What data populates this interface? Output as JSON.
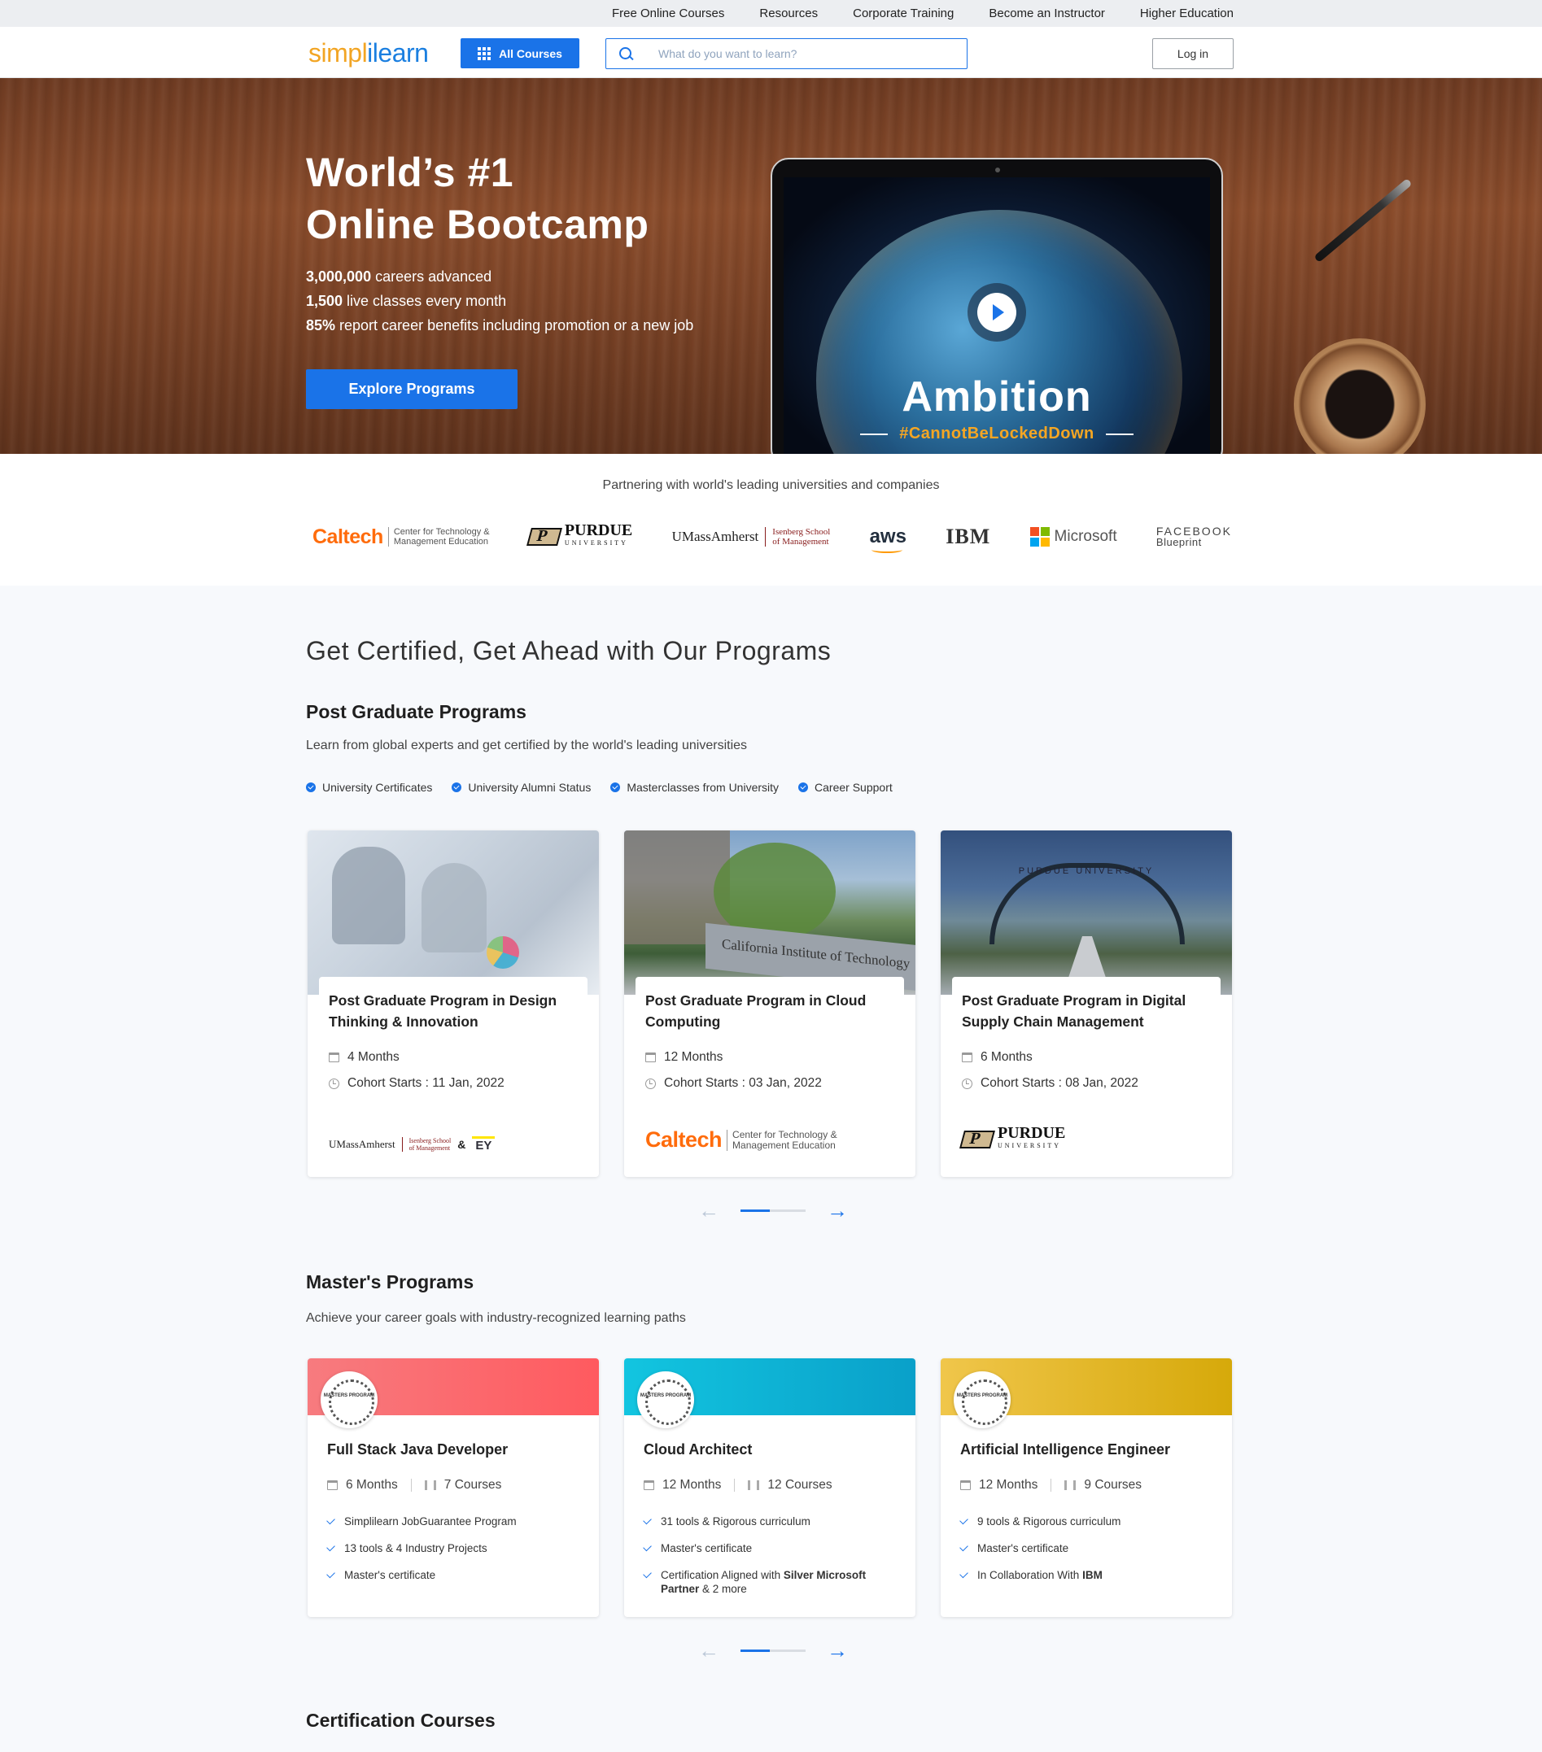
{
  "util_nav": [
    "Free Online Courses",
    "Resources",
    "Corporate Training",
    "Become an Instructor",
    "Higher Education"
  ],
  "header": {
    "logo_a": "simpl",
    "logo_b": "ilearn",
    "all_courses": "All Courses",
    "search_placeholder": "What do you want to learn?",
    "login": "Log in"
  },
  "hero": {
    "title_line1": "World’s #1",
    "title_line2": "Online Bootcamp",
    "stats": [
      {
        "num": "3,000,000",
        "text": " careers advanced"
      },
      {
        "num": "1,500",
        "text": " live classes every month"
      },
      {
        "num": "85%",
        "text": " report career benefits including promotion or a new job"
      }
    ],
    "cta": "Explore Programs",
    "video_title": "Ambition",
    "video_hashtag": "#CannotBeLockedDown"
  },
  "partners": {
    "title": "Partnering with world's leading universities and companies",
    "caltech": "Caltech",
    "caltech_sub1": "Center for Technology &",
    "caltech_sub2": "Management Education",
    "purdue": "PURDUE",
    "purdue_sub": "UNIVERSITY",
    "umass": "UMassAmherst",
    "umass_sub1": "Isenberg School",
    "umass_sub2": "of Management",
    "aws": "aws",
    "ibm": "IBM",
    "microsoft": "Microsoft",
    "fb_top": "FACEBOOK",
    "fb_bottom": "Blueprint",
    "ey": "EY"
  },
  "colors": {
    "accent": "#1a73e8",
    "caltech": "#ff6c0c",
    "ms_red": "#f25022",
    "ms_green": "#7fba00",
    "ms_blue": "#00a4ef",
    "ms_yellow": "#ffb900"
  },
  "programs": {
    "section_title": "Get Certified, Get Ahead with Our Programs",
    "pg_title": "Post Graduate Programs",
    "pg_desc": "Learn from global experts and get certified by the world's leading universities",
    "features": [
      "University Certificates",
      "University Alumni Status",
      "Masterclasses from University",
      "Career Support"
    ],
    "pg_cards": [
      {
        "title": "Post Graduate Program in Design Thinking & Innovation",
        "duration": "4 Months",
        "cohort": "Cohort Starts : 11 Jan, 2022"
      },
      {
        "title": "Post Graduate Program in Cloud Computing",
        "duration": "12 Months",
        "cohort": "Cohort Starts : 03 Jan, 2022"
      },
      {
        "title": "Post Graduate Program in Digital Supply Chain Management",
        "duration": "6 Months",
        "cohort": "Cohort Starts : 08 Jan, 2022"
      }
    ],
    "pg_img_texts": [
      "California Institute of Technology",
      "PURDUE UNIVERSITY"
    ],
    "pg_logo_amp": "&",
    "mp_title": "Master's Programs",
    "mp_desc": "Achieve your career goals with industry-recognized learning paths",
    "badge_text": "MASTERS PROGRAM",
    "mp_cards": [
      {
        "title": "Full Stack Java Developer",
        "duration": "6 Months",
        "courses": "7 Courses",
        "points": [
          "Simplilearn JobGuarantee Program",
          "13 tools & 4 Industry Projects",
          "Master's certificate"
        ]
      },
      {
        "title": "Cloud Architect",
        "duration": "12 Months",
        "courses": "12 Courses",
        "points": [
          "31 tools & Rigorous curriculum",
          "Master's certificate"
        ],
        "point3_pre": "Certification Aligned with ",
        "point3_bold": "Silver Microsoft Partner",
        "point3_post": " & 2 more"
      },
      {
        "title": "Artificial Intelligence Engineer",
        "duration": "12 Months",
        "courses": "9 Courses",
        "points": [
          "9 tools & Rigorous curriculum",
          "Master's certificate"
        ],
        "point3_pre": "In Collaboration With ",
        "point3_bold": "IBM"
      }
    ],
    "cert_title": "Certification Courses"
  }
}
